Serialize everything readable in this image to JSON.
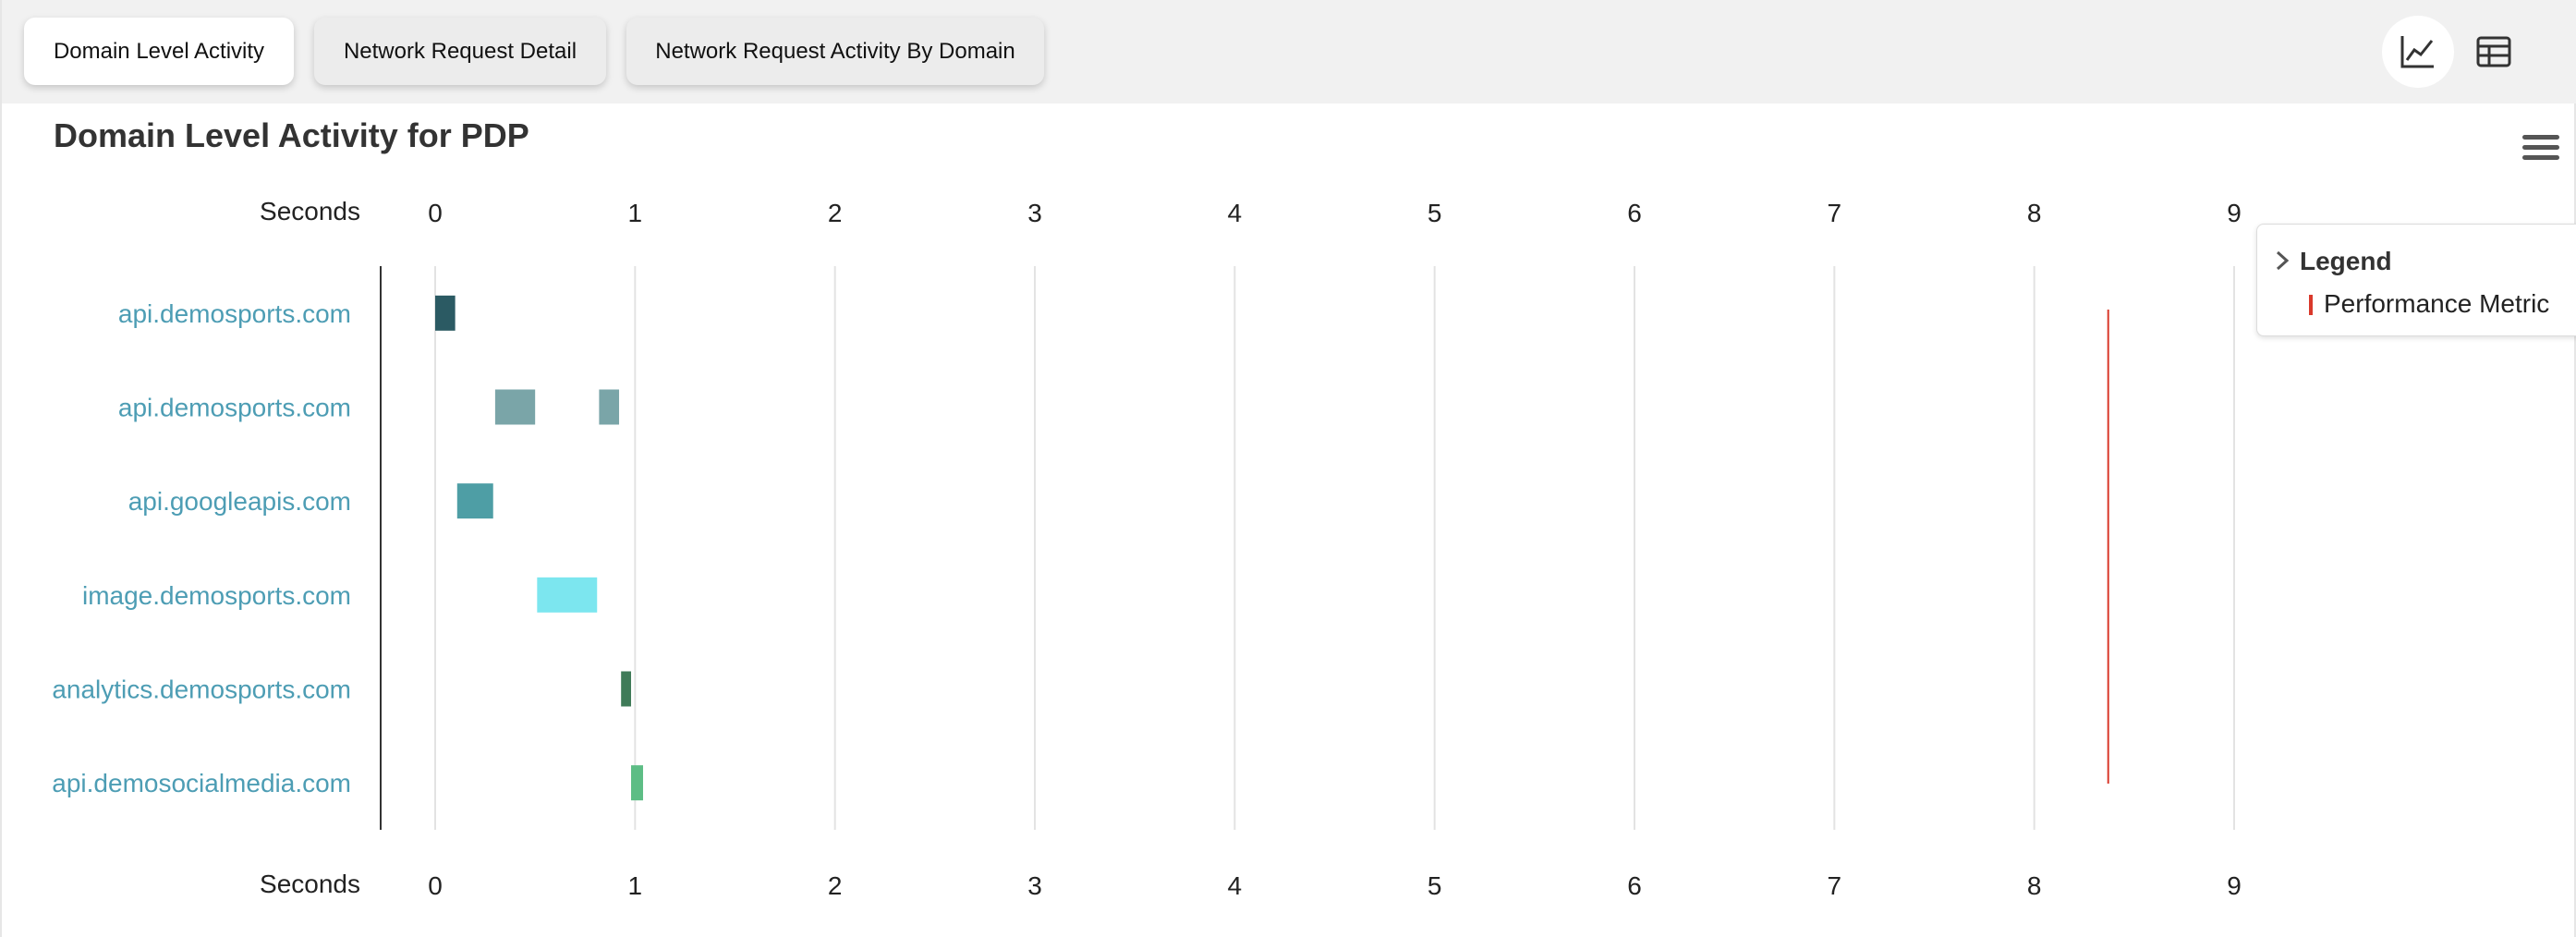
{
  "tabs": [
    {
      "label": "Domain Level Activity",
      "active": true
    },
    {
      "label": "Network Request Detail",
      "active": false
    },
    {
      "label": "Network Request Activity By Domain",
      "active": false
    }
  ],
  "view_buttons": [
    {
      "icon": "line-chart-icon",
      "active": true
    },
    {
      "icon": "table-icon",
      "active": false
    }
  ],
  "legend": {
    "title": "Legend",
    "items": [
      {
        "label": "Performance Metric",
        "color": "#d9392b"
      }
    ]
  },
  "chart_data": {
    "type": "bar",
    "title": "Domain Level Activity for PDP",
    "xlabel": "Seconds",
    "xlim": [
      0,
      9
    ],
    "xticks": [
      "0",
      "1",
      "2",
      "3",
      "4",
      "5",
      "6",
      "7",
      "8",
      "9"
    ],
    "grid": true,
    "legend_position": "top-right",
    "categories": [
      "api.demosports.com",
      "api.demosports.com",
      "api.googleapis.com",
      "image.demosports.com",
      "analytics.demosports.com",
      "api.demosocialmedia.com"
    ],
    "ranges": [
      {
        "category": 0,
        "start": 0.0,
        "end": 0.1,
        "color": "#2b5a63"
      },
      {
        "category": 1,
        "start": 0.3,
        "end": 0.5,
        "color": "#7aa5a8"
      },
      {
        "category": 1,
        "start": 0.82,
        "end": 0.92,
        "color": "#7aa5a8"
      },
      {
        "category": 2,
        "start": 0.11,
        "end": 0.29,
        "color": "#4e9ea5"
      },
      {
        "category": 3,
        "start": 0.51,
        "end": 0.81,
        "color": "#7ce6ef"
      },
      {
        "category": 4,
        "start": 0.93,
        "end": 0.98,
        "color": "#3f7b58"
      },
      {
        "category": 5,
        "start": 0.98,
        "end": 1.04,
        "color": "#5dbd85"
      }
    ],
    "markers": [
      {
        "name": "Performance Metric",
        "x": 8.37,
        "color": "#d9392b"
      }
    ]
  }
}
